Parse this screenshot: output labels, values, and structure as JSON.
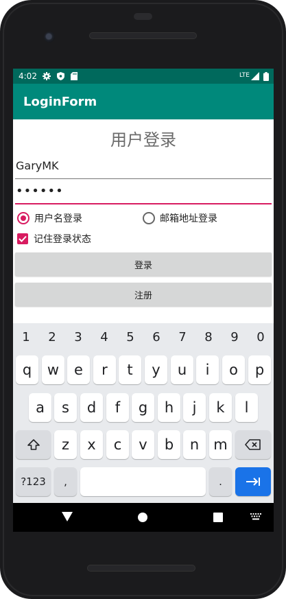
{
  "status_bar": {
    "time": "4:02",
    "network": "LTE",
    "icons": [
      "settings-icon",
      "shield-icon",
      "sd-card-icon",
      "signal-icon",
      "battery-icon"
    ]
  },
  "app_bar": {
    "title": "LoginForm"
  },
  "form": {
    "heading": "用户登录",
    "username_value": "GaryMK",
    "password_value": "••••••",
    "radio_username_label": "用户名登录",
    "radio_email_label": "邮箱地址登录",
    "remember_label": "记住登录状态",
    "login_button": "登录",
    "register_button": "注册"
  },
  "keyboard": {
    "numbers": [
      "1",
      "2",
      "3",
      "4",
      "5",
      "6",
      "7",
      "8",
      "9",
      "0"
    ],
    "row1": [
      "q",
      "w",
      "e",
      "r",
      "t",
      "y",
      "u",
      "i",
      "o",
      "p"
    ],
    "row2": [
      "a",
      "s",
      "d",
      "f",
      "g",
      "h",
      "j",
      "k",
      "l"
    ],
    "row3": [
      "z",
      "x",
      "c",
      "v",
      "b",
      "n",
      "m"
    ],
    "symbols_key": "?123",
    "comma_key": ",",
    "period_key": "."
  },
  "colors": {
    "status_bar": "#00695c",
    "app_bar": "#00897b",
    "accent": "#d81b60",
    "enter_key": "#1a73e8"
  }
}
